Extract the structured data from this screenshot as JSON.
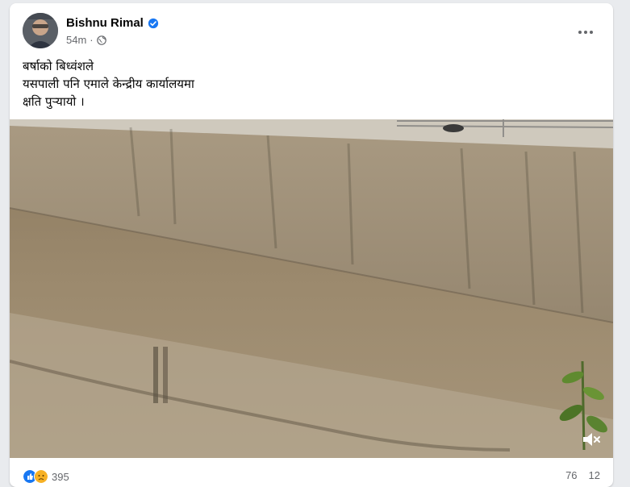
{
  "post": {
    "author": "Bishnu Rimal",
    "time": "54m",
    "privacy_icon": "globe-icon",
    "verified_icon": "verified-badge-icon",
    "text_lines": [
      "बर्षाको बिध्वंशले",
      "यसपाली पनि एमाले केन्द्रीय कार्यालयमा",
      "क्षति पुऱ्यायो ।"
    ]
  },
  "media": {
    "type": "video",
    "mute_icon": "speaker-muted-icon"
  },
  "footer": {
    "reaction_count": "395",
    "comments": "76",
    "shares": "12"
  },
  "colors": {
    "accent": "#1877f2",
    "text": "#050505",
    "muted": "#65676b"
  }
}
